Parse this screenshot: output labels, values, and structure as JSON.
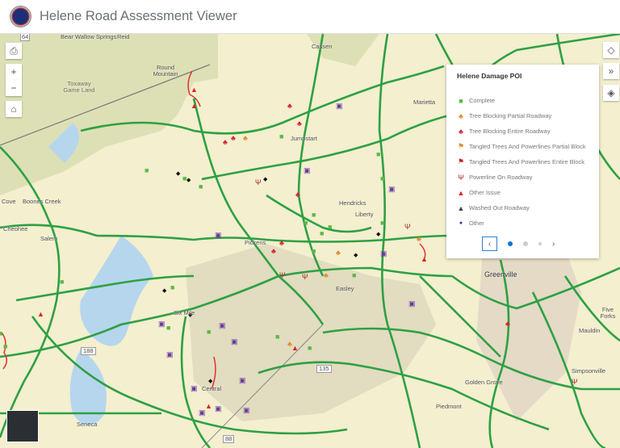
{
  "header": {
    "title": "Helene Road Assessment Viewer",
    "logo": "seal-logo"
  },
  "map": {
    "labels": [
      "Bear Wallow Springs",
      "Reid",
      "Round Mountain",
      "Toxaway Game Land",
      "Cove",
      "Boones Creek",
      "Cheohee",
      "Salem",
      "Pickens",
      "Easley",
      "Greenville",
      "Six Mile",
      "Central",
      "Seneca",
      "Five Forks",
      "Mauldin",
      "Simpsonville",
      "Golden Grove",
      "Piedmont",
      "Marietta",
      "Cassen",
      "Hendricks",
      "Jumpstart",
      "Liberty"
    ],
    "shields": [
      "64",
      "188",
      "135",
      "88"
    ]
  },
  "toolbar": {
    "print": "print-icon",
    "zoom_in": "+",
    "zoom_out": "−",
    "home": "home-icon"
  },
  "right_tools": {
    "locate": "locate-icon",
    "expand": "»",
    "layers": "layers-icon"
  },
  "legend": {
    "title": "Helene Damage POI",
    "items": [
      {
        "label": "Complete",
        "color": "#5cb848"
      },
      {
        "label": "Tree Blocking Partial Roadway",
        "color": "#e08a2a"
      },
      {
        "label": "Tree Blocking Entire Roadway",
        "color": "#d4202a"
      },
      {
        "label": "Tangled Trees And Powerlines Partial Block",
        "color": "#e08a2a"
      },
      {
        "label": "Tangled Trees And Powerlines Entire Block",
        "color": "#c8202a"
      },
      {
        "label": "Powerline On Roadway",
        "color": "#a52a2a"
      },
      {
        "label": "Other Issue",
        "color": "#e02020"
      },
      {
        "label": "Washed Out Roadway",
        "color": "#444444"
      },
      {
        "label": "Other",
        "color": "#3a2a9a"
      }
    ],
    "pager": {
      "prev": "‹",
      "next": "›",
      "pages": 4,
      "current": 1
    }
  }
}
